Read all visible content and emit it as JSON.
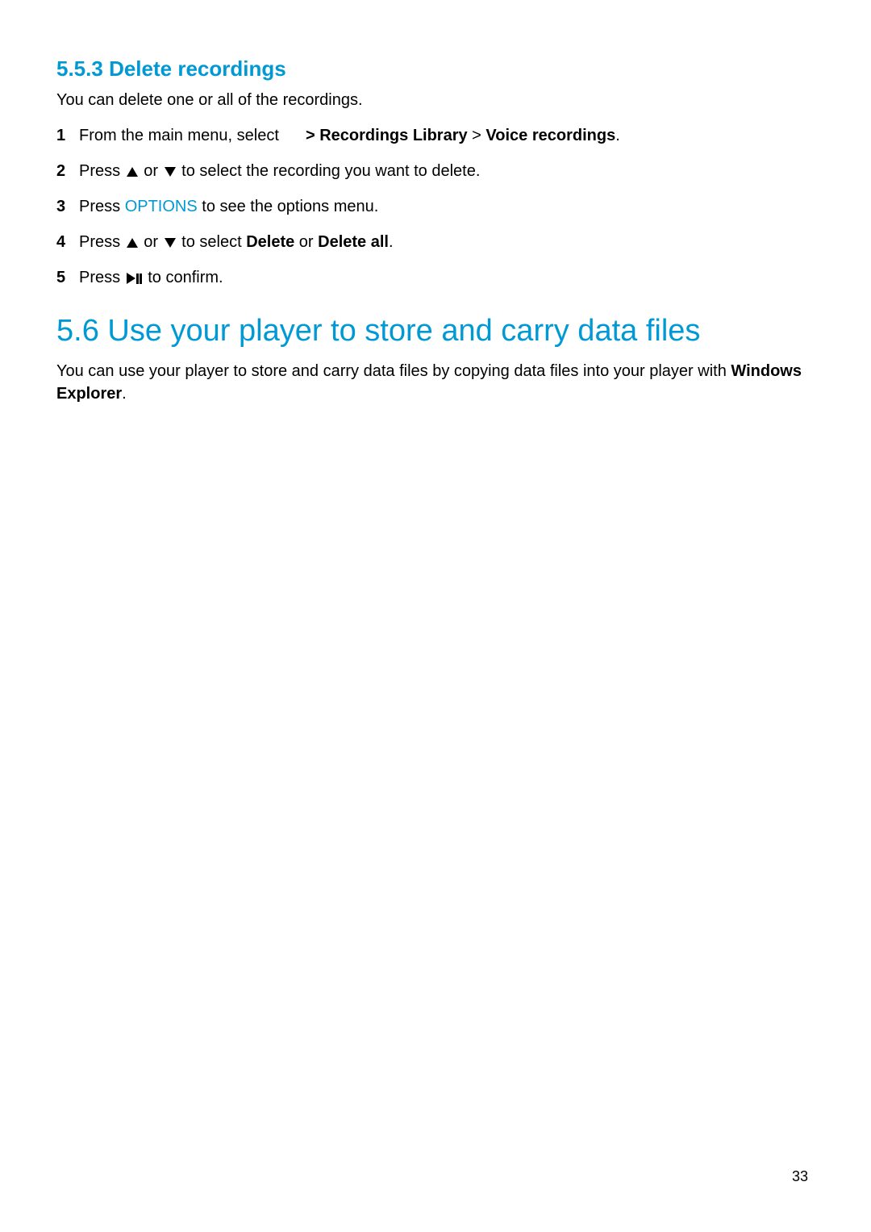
{
  "section_553": {
    "number": "5.5.3",
    "title": "Delete recordings",
    "intro": "You can delete one or all of the recordings.",
    "steps": [
      {
        "num": "1",
        "prefix": "From the main menu, select ",
        "bold1": "> Recordings Library",
        "mid": " > ",
        "bold2": "Voice recordings",
        "suffix": "."
      },
      {
        "num": "2",
        "prefix": "Press ",
        "mid": " or ",
        "suffix": " to select the recording you want to delete."
      },
      {
        "num": "3",
        "prefix": "Press ",
        "options": "OPTIONS",
        "suffix": " to see the options menu."
      },
      {
        "num": "4",
        "prefix": "Press ",
        "mid": " or ",
        "mid2": " to select ",
        "bold1": "Delete",
        "mid3": " or ",
        "bold2": "Delete all",
        "suffix": "."
      },
      {
        "num": "5",
        "prefix": "Press ",
        "suffix": " to confirm."
      }
    ]
  },
  "section_56": {
    "number": "5.6",
    "title": "Use your player to store and carry data files",
    "para_prefix": "You can use your player to store and carry data files by copying data files into your player with ",
    "bold": "Windows Explorer",
    "para_suffix": "."
  },
  "page_number": "33"
}
